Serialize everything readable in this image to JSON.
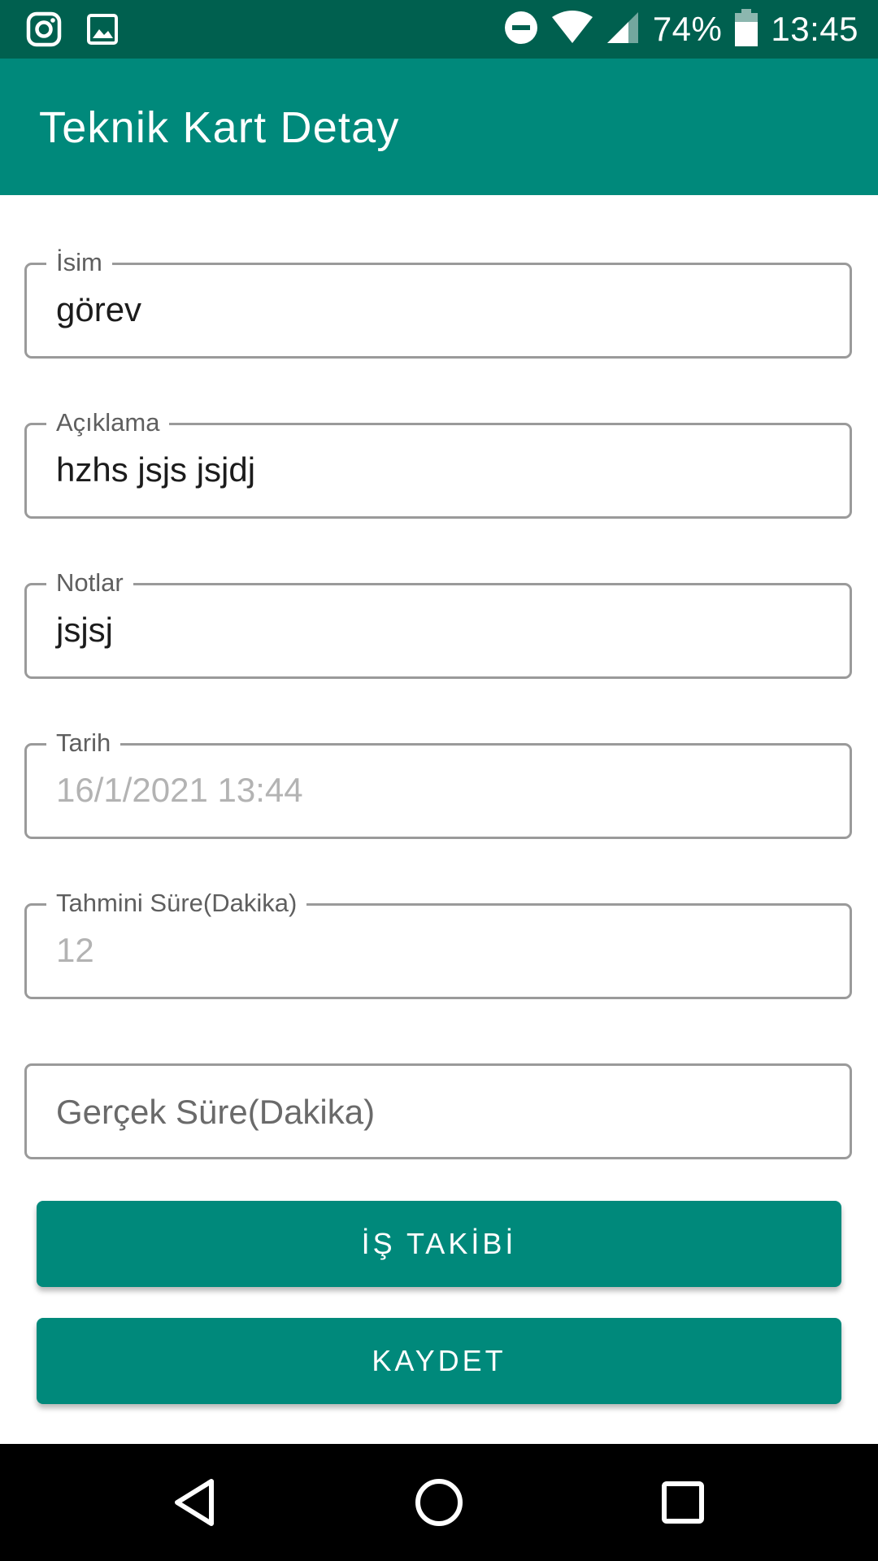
{
  "status_bar": {
    "battery_percent": "74%",
    "time": "13:45",
    "left_icons": [
      "instagram-icon",
      "image-icon"
    ],
    "right_icons": [
      "do-not-disturb-icon",
      "wifi-icon",
      "signal-icon",
      "battery-icon"
    ]
  },
  "app_bar": {
    "title": "Teknik Kart Detay",
    "background_color": "#00897b"
  },
  "form": {
    "name": {
      "label": "İsim",
      "value": "görev"
    },
    "description": {
      "label": "Açıklama",
      "value": "hzhs jsjs jsjdj"
    },
    "notes": {
      "label": "Notlar",
      "value": "jsjsj"
    },
    "date": {
      "label": "Tarih",
      "value": "16/1/2021 13:44"
    },
    "estimated_duration": {
      "label": "Tahmini Süre(Dakika)",
      "value": "12"
    },
    "actual_duration": {
      "placeholder": "Gerçek Süre(Dakika)"
    }
  },
  "buttons": {
    "work_tracking": "İŞ TAKİBİ",
    "save": "KAYDET"
  },
  "nav_bar": {
    "icons": [
      "back-icon",
      "home-icon",
      "recents-icon"
    ]
  },
  "colors": {
    "status_bar": "#00604f",
    "accent": "#00897b"
  }
}
